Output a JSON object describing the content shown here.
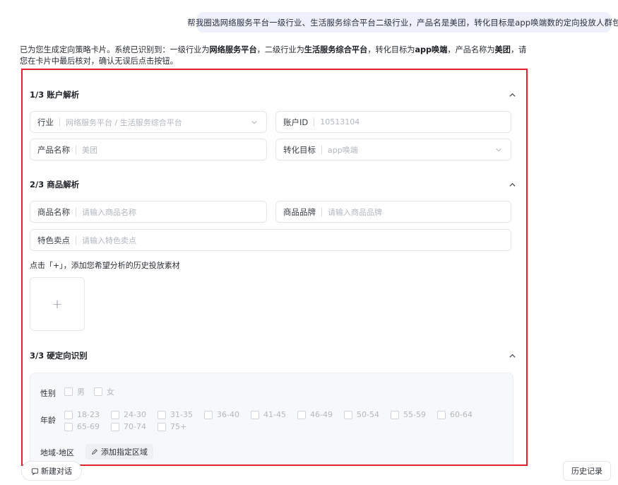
{
  "user_message": "帮我圈选网络服务平台一级行业、生活服务综合平台二级行业，产品名是美团，转化目标是app唤端数的定向投放人群包",
  "assistant": {
    "p1": "已为您生成定向策略卡片。系统已识别到：一级行业为",
    "b1": "网络服务平台",
    "p2": "，二级行业为",
    "b2": "生活服务综合平台",
    "p3": "，转化目标为",
    "b3": "app唤端",
    "p4": "，产品名称为",
    "b4": "美团",
    "p5": "，请您在卡片中最后核对，确认无误后点击按钮。"
  },
  "card": {
    "section1": {
      "title": "1/3 账户解析",
      "industry_label": "行业",
      "industry_value": "网络服务平台 / 生活服务综合平台",
      "account_label": "账户ID",
      "account_value": "10513104",
      "product_label": "产品名称",
      "product_value": "美团",
      "goal_label": "转化目标",
      "goal_value": "app唤端"
    },
    "section2": {
      "title": "2/3 商品解析",
      "goods_name_label": "商品名称",
      "goods_name_placeholder": "请输入商品名称",
      "goods_brand_label": "商品品牌",
      "goods_brand_placeholder": "请输入商品品牌",
      "selling_label": "特色卖点",
      "selling_placeholder": "请输入特色卖点",
      "upload_hint": "点击「+」，添加您希望分析的历史投放素材",
      "upload_plus": "+"
    },
    "section3": {
      "title": "3/3 硬定向识别",
      "gender_label": "性别",
      "gender_options": [
        "男",
        "女"
      ],
      "age_label": "年龄",
      "age_options": [
        "18-23",
        "24-30",
        "31-35",
        "36-40",
        "41-45",
        "46-49",
        "50-54",
        "55-59",
        "60-64",
        "65-69",
        "70-74",
        "75+"
      ],
      "region_label": "地域-地区",
      "add_region": "添加指定区域"
    }
  },
  "bottom": {
    "new_chat": "新建对话",
    "history": "历史记录"
  },
  "colors": {
    "highlight_border": "#e0222a",
    "user_bubble": "#eef1fb"
  }
}
